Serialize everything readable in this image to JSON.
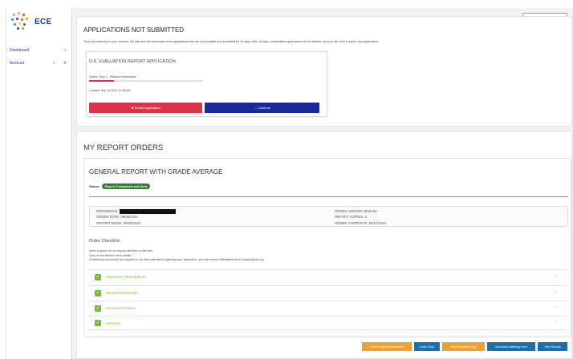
{
  "logo": {
    "text": "ECE"
  },
  "sidebar": {
    "items": [
      {
        "label": "Dashboard",
        "icon": "home-icon"
      },
      {
        "label": "Account",
        "icon": "menu-icon"
      }
    ]
  },
  "applications": {
    "title": "APPLICATIONS NOT SUBMITTED",
    "intro": "Thank for returning to your account. We will save the information from applications that are not complete and submitted for 15 days. After 15 days, unsubmitted applications will be deleted, and you will need to start a new application.",
    "card": {
      "title": "U.S. EVALUATION REPORT APPLICATION",
      "status": "Status: Step 1 - Personal Information",
      "created": "Created: Sep 16 2024 10:48 AM",
      "delete_label": "✖ Delete Application",
      "continue_label": "→ Continue"
    }
  },
  "orders": {
    "title": "MY REPORT ORDERS",
    "report": {
      "title": "GENERAL REPORT WITH GRADE AVERAGE",
      "status_label": "Status:",
      "status_badge": "Report Completed and Sent",
      "details_left": [
        "REFERENCE",
        "ORDER DATE: 09/09/2024",
        "REPORT DONE: 09/26/2024"
      ],
      "details_right": [
        "ORDER AMOUNT: $225.00",
        "REPORT COPIES: 2",
        "ORDER COMPLETE: 09/27/2024"
      ],
      "checklist_title": "Order Checklist",
      "checklist_notes": [
        "Items in green do not require attention at this time.",
        "Click on red items to view details.",
        "If additional documents are required or we have questions regarding your application, you will receive notifications from noreply@ece.org."
      ],
      "checklist_items": [
        "Payment(s) Made $225.00",
        "Required Documents",
        "General Information",
        "Deliveries"
      ],
      "buttons": [
        {
          "label": "How to Submit Documents",
          "color": "#f0a030"
        },
        {
          "label": "Order Copy",
          "color": "#1a6fb0"
        },
        {
          "label": "View Electronic Copy",
          "color": "#f0a030"
        },
        {
          "label": "Document Matching Form",
          "color": "#1a6fb0"
        },
        {
          "label": "View Receipt",
          "color": "#1a6fb0"
        }
      ]
    }
  },
  "colors": {
    "delete": "#d9344a",
    "continue": "#1a2a9c",
    "badge": "#2e7d32",
    "check": "#7cb342",
    "divider": "#3fae8f"
  }
}
